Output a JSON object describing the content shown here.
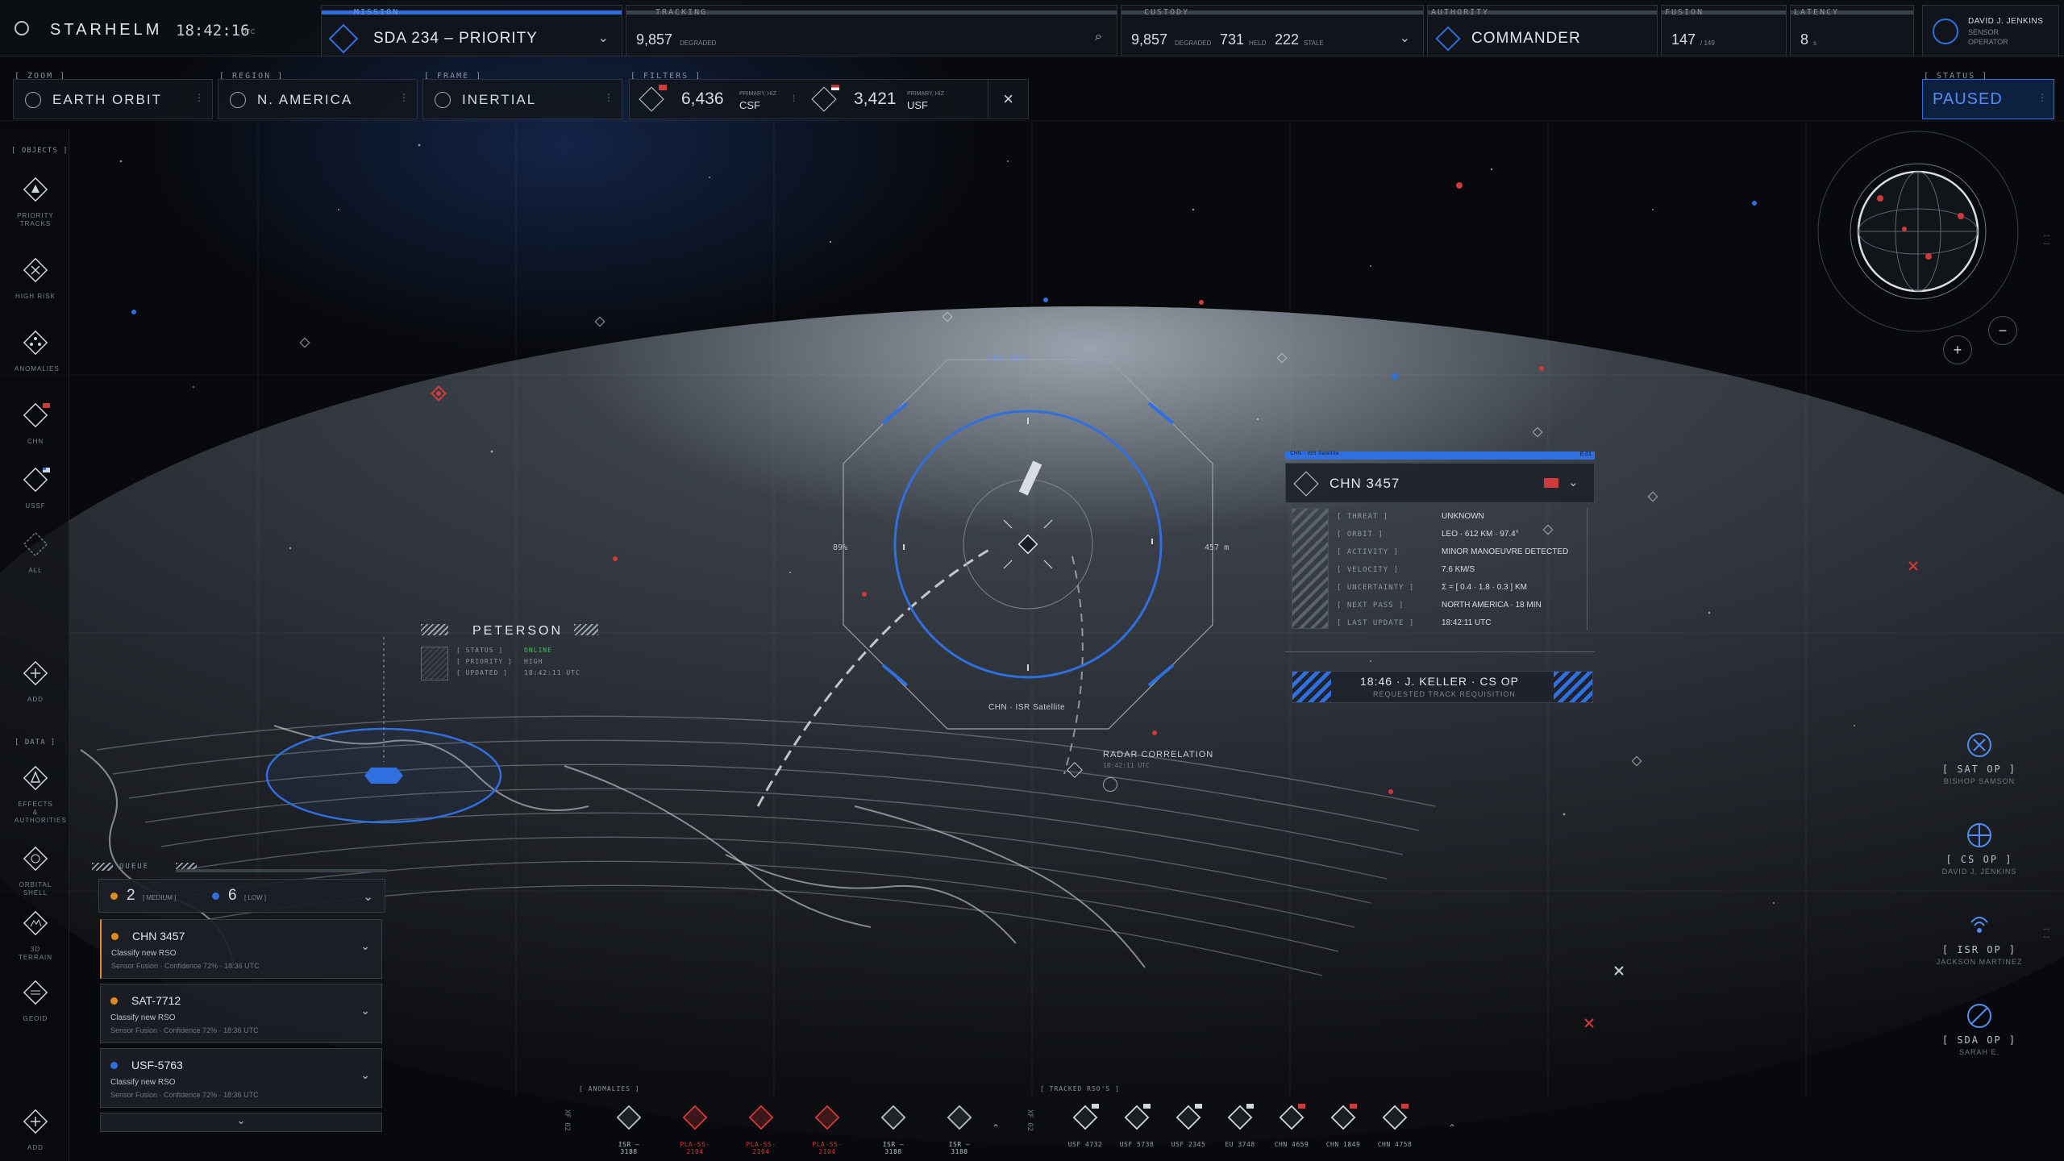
{
  "app": {
    "name": "STARHELM",
    "clock": "18:42:16",
    "clock_unit": "UTC"
  },
  "header": {
    "mission": {
      "label": "MISSION",
      "value": "SDA 234 – PRIORITY"
    },
    "tracking": {
      "label": "TRACKING",
      "count": "9,857",
      "sub": "DEGRADED"
    },
    "custody": {
      "label": "CUSTODY",
      "v1": "9,857",
      "s1": "DEGRADED",
      "v2": "731",
      "s2": "HELD",
      "v3": "222",
      "s3": "STALE"
    },
    "authority": {
      "label": "AUTHORITY",
      "value": "COMMANDER"
    },
    "fusion": {
      "label": "FUSION",
      "value": "147",
      "sub": "/ 149"
    },
    "latency": {
      "label": "LATENCY",
      "value": "8",
      "sub": "s"
    },
    "user": {
      "name": "DAVID J. JENKINS",
      "role1": "SENSOR",
      "role2": "OPERATOR"
    }
  },
  "filters_row": {
    "zoom": {
      "label": "[ ZOOM ]",
      "value": "EARTH ORBIT"
    },
    "region": {
      "label": "[ REGION ]",
      "value": "N. AMERICA"
    },
    "frame": {
      "label": "[ FRAME ]",
      "value": "INERTIAL"
    },
    "filters": {
      "label": "[ FILTERS ]",
      "v1": "6,436",
      "t1": "CSF",
      "s1": "PRIMARY, HIZ",
      "v2": "3,421",
      "t2": "USF",
      "s2": "PRIMARY, HIZ"
    },
    "status": {
      "label": "[ STATUS ]",
      "value": "PAUSED"
    }
  },
  "left_rail": {
    "objects_label": "[ OBJECTS ]",
    "data_label": "[ DATA ]",
    "items": [
      "PRIORITY TRACKS",
      "HIGH RISK",
      "ANOMALIES",
      "CHN",
      "USSF",
      "ALL",
      "ADD"
    ],
    "data_items": [
      "EFFECTS & AUTHORITIES",
      "ORBITAL SHELL",
      "3D TERRAIN",
      "GEOID",
      "ADD"
    ]
  },
  "target": {
    "header_tag": "CHN 3457",
    "footer": "CHN · ISR Satellite",
    "left_pct": "89%",
    "right_range": "457 m"
  },
  "detail": {
    "tag": "CHN · ISR Satellite",
    "tag_right": "E.01",
    "name": "CHN 3457",
    "rows": [
      {
        "k": "[ THREAT ]",
        "v": "UNKNOWN"
      },
      {
        "k": "[ ORBIT ]",
        "v": "LEO · 612 KM · 97.4°"
      },
      {
        "k": "[ ACTIVITY ]",
        "v": "MINOR MANOEUVRE DETECTED"
      },
      {
        "k": "[ VELOCITY ]",
        "v": "7.6 KM/S"
      },
      {
        "k": "[ UNCERTAINTY ]",
        "v": "Σ = [ 0.4 · 1.8 · 0.3 ] KM"
      },
      {
        "k": "[ NEXT PASS ]",
        "v": "NORTH AMERICA · 18 MIN"
      },
      {
        "k": "[ LAST UPDATE ]",
        "v": "18:42:11 UTC"
      }
    ],
    "note_title": "18:46 · J. KELLER · CS OP",
    "note_sub": "REQUESTED TRACK REQUISITION"
  },
  "station": {
    "name": "PETERSON",
    "rows": [
      {
        "k": "[ STATUS ]",
        "v": "ONLINE"
      },
      {
        "k": "[ PRIORITY ]",
        "v": "HIGH"
      },
      {
        "k": "[ UPDATED ]",
        "v": "18:42:11 UTC"
      }
    ]
  },
  "radar": {
    "title": "RADAR CORRELATION",
    "time": "18:42:11 UTC"
  },
  "queue": {
    "label": "QUEUE",
    "med_count": "2",
    "med_label": "[ MEDIUM ]",
    "low_count": "6",
    "low_label": "[ LOW ]",
    "items": [
      {
        "id": "CHN 3457",
        "desc": "Classify new RSO",
        "meta": "Sensor Fusion · Confidence 72% · 18:36 UTC",
        "dot": "#e08a1e"
      },
      {
        "id": "SAT-7712",
        "desc": "Classify new RSO",
        "meta": "Sensor Fusion · Confidence 72% · 18:36 UTC",
        "dot": "#e08a1e"
      },
      {
        "id": "USF-5763",
        "desc": "Classify new RSO",
        "meta": "Sensor Fusion · Confidence 72% · 18:36 UTC",
        "dot": "#2f6fe0"
      }
    ]
  },
  "operators": [
    {
      "role": "[ SAT OP ]",
      "name": "BISHOP SAMSON"
    },
    {
      "role": "[ CS OP ]",
      "name": "DAVID J. JENKINS"
    },
    {
      "role": "[ ISR OP ]",
      "name": "JACKSON MARTINEZ"
    },
    {
      "role": "[ SDA OP ]",
      "name": "SARAH E."
    }
  ],
  "bottom": {
    "anomalies_label": "[ ANOMALIES ]",
    "tracked_label": "[ TRACKED RSO'S ]",
    "left_tag": "XF 02",
    "right_tag": "XF 02",
    "anomalies": [
      "ISR – 3188",
      "PLA-SS-2104",
      "PLA-SS-2104",
      "PLA-SS-2104",
      "ISR – 3188",
      "ISR – 3188"
    ],
    "tracked": [
      "USF 4732",
      "USF 5738",
      "USF 2345",
      "EU 3748",
      "CHN 4659",
      "CHN 1849",
      "CHN 4758"
    ]
  },
  "colors": {
    "accent": "#2f6fe0",
    "threat": "#d13a3a",
    "warn": "#e08a1e",
    "online": "#3fbf5f"
  }
}
